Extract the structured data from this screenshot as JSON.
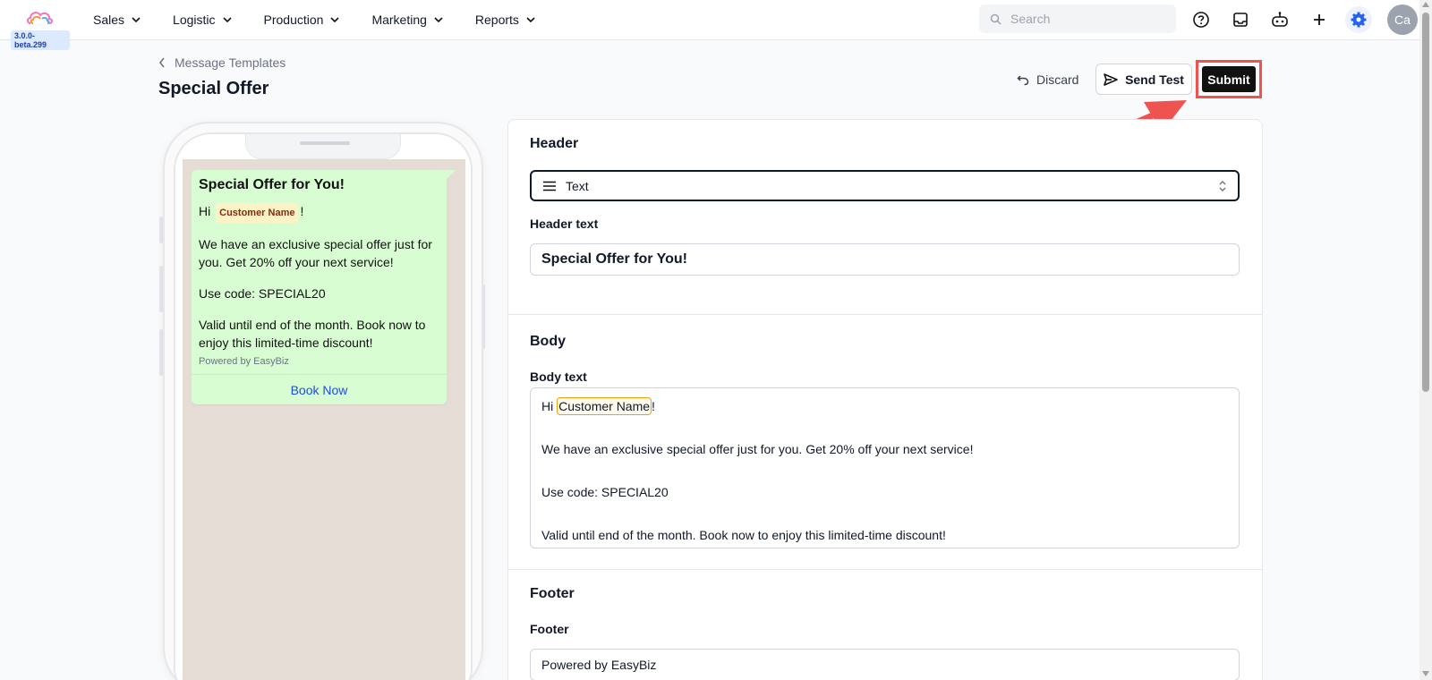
{
  "app": {
    "version": "3.0.0-beta.299",
    "accent": "#2563eb",
    "avatar_initials": "Ca"
  },
  "nav": {
    "items": [
      {
        "label": "Sales"
      },
      {
        "label": "Logistic"
      },
      {
        "label": "Production"
      },
      {
        "label": "Marketing"
      },
      {
        "label": "Reports"
      }
    ],
    "search_placeholder": "Search"
  },
  "page": {
    "breadcrumb": "Message Templates",
    "title": "Special Offer",
    "discard_label": "Discard",
    "send_test_label": "Send Test",
    "submit_label": "Submit"
  },
  "preview": {
    "header": "Special Offer for You!",
    "greeting_prefix": "Hi",
    "variable_chip": "Customer Name",
    "greeting_suffix": "!",
    "paragraph1": "We have an exclusive special offer just for you. Get 20% off your next service!",
    "paragraph2": "Use code: SPECIAL20",
    "paragraph3": "Valid until end of the month. Book now to enjoy this limited-time discount!",
    "footer": "Powered by EasyBiz",
    "cta": "Book Now"
  },
  "form": {
    "header_section_title": "Header",
    "header_type_value": "Text",
    "header_text_label": "Header text",
    "header_text_value": "Special Offer for You!",
    "body_section_title": "Body",
    "body_text_label": "Body text",
    "body_greeting_prefix": "Hi ",
    "body_variable": "Customer Name",
    "body_greeting_suffix": "!",
    "body_paragraph1": "We have an exclusive special offer just for you. Get 20% off your next service!",
    "body_paragraph2": "Use code: SPECIAL20",
    "body_paragraph3": "Valid until end of the month. Book now to enjoy this limited-time discount!",
    "footer_section_title": "Footer",
    "footer_label": "Footer",
    "footer_value": "Powered by EasyBiz"
  }
}
